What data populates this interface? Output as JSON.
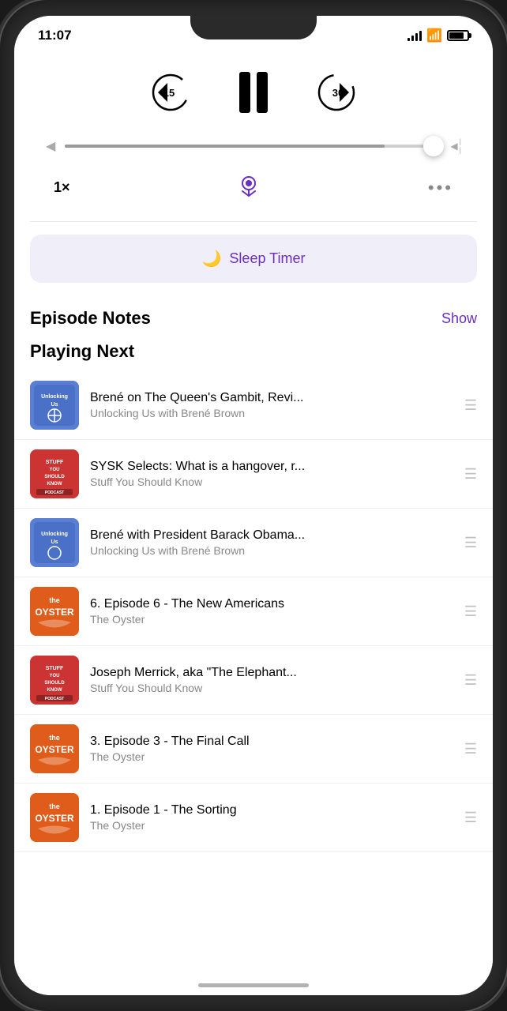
{
  "status_bar": {
    "time": "11:07"
  },
  "player": {
    "rewind_label": "15",
    "forward_label": "30",
    "speed_label": "1×",
    "sleep_timer_label": "Sleep Timer",
    "episode_notes_label": "Episode Notes",
    "show_label": "Show",
    "playing_next_label": "Playing Next"
  },
  "episodes": [
    {
      "title": "Brené on The Queen's Gambit, Revi...",
      "podcast": "Unlocking Us with Brené Brown",
      "art_type": "unlocking"
    },
    {
      "title": "SYSK Selects: What is a hangover, r...",
      "podcast": "Stuff You Should Know",
      "art_type": "sysk"
    },
    {
      "title": "Brené with President Barack Obama...",
      "podcast": "Unlocking Us with Brené Brown",
      "art_type": "unlocking"
    },
    {
      "title": "6. Episode 6 - The New Americans",
      "podcast": "The Oyster",
      "art_type": "oyster"
    },
    {
      "title": "Joseph Merrick, aka \"The Elephant...",
      "podcast": "Stuff You Should Know",
      "art_type": "sysk"
    },
    {
      "title": "3. Episode 3 - The Final Call",
      "podcast": "The Oyster",
      "art_type": "oyster"
    },
    {
      "title": "1. Episode 1 - The Sorting",
      "podcast": "The Oyster",
      "art_type": "oyster"
    }
  ],
  "colors": {
    "purple": "#6B2DBD",
    "gray_text": "#888888",
    "track_bg": "#d0d0d0"
  }
}
